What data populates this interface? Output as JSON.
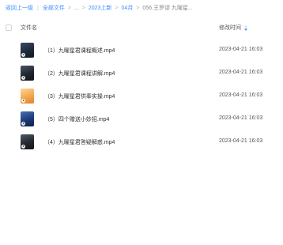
{
  "breadcrumb": {
    "back": "返回上一级",
    "all_files": "全部文件",
    "ellipsis": "...",
    "folder_a": "2023上新",
    "folder_b": "04月",
    "current": "056.王罗谬 九曜星..."
  },
  "table": {
    "col_name": "文件名",
    "col_modified": "修改时间"
  },
  "files": [
    {
      "name": "（1）九曜星君课程概述.mp4",
      "modified": "2023-04-21 16:03",
      "thumb_color": "#1d2a3c"
    },
    {
      "name": "（2）九曜星君课程讲解.mp4",
      "modified": "2023-04-21 16:03",
      "thumb_color": "#1f2630"
    },
    {
      "name": "（3）九曜星君供奉实操.mp4",
      "modified": "2023-04-21 16:03",
      "thumb_color": "#f2a64e"
    },
    {
      "name": "（5）四个赠送小妙招.mp4",
      "modified": "2023-04-21 16:03",
      "thumb_color": "#1c3a78"
    },
    {
      "name": "（4）九曜星君答疑解惑.mp4",
      "modified": "2023-04-21 16:03",
      "thumb_color": "#23282f"
    }
  ],
  "colors": {
    "link": "#3b8cff",
    "sort_icon": "#3b8cff"
  }
}
